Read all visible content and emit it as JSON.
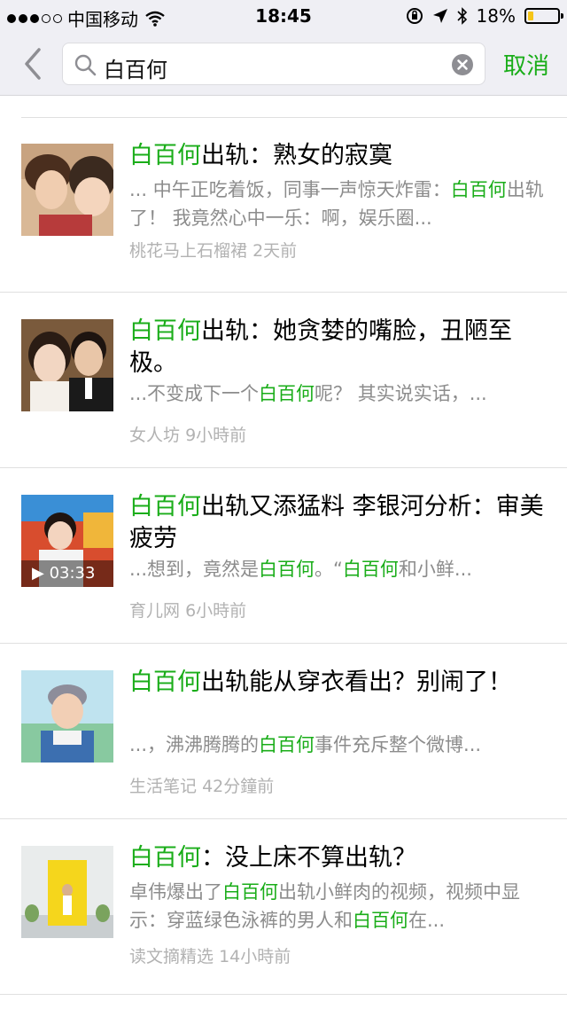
{
  "status_bar": {
    "carrier": "中国移动",
    "time": "18:45",
    "battery_percent": "18%",
    "battery_level": 0.18,
    "icons": [
      "signal-dots-icon",
      "wifi-icon",
      "orientation-lock-icon",
      "location-icon",
      "bluetooth-icon",
      "battery-icon"
    ]
  },
  "search": {
    "query": "白百何",
    "cancel_label": "取消"
  },
  "colors": {
    "accent": "#1aad19",
    "snippet": "#8c8c8c",
    "meta": "#b2b2b2",
    "header_bg": "#efeff4"
  },
  "results": [
    {
      "title": [
        {
          "t": "白百何",
          "hl": true
        },
        {
          "t": "出轨：熟女的寂寞",
          "hl": false
        }
      ],
      "snippet": [
        {
          "t": "... 中午正吃着饭，同事一声惊天炸雷：",
          "hl": false
        },
        {
          "t": "白百何",
          "hl": true
        },
        {
          "t": "出轨了！ 我竟然心中一乐：啊，娱乐圈...",
          "hl": false
        }
      ],
      "source": "桃花马上石榴裙",
      "time": "2天前"
    },
    {
      "title": [
        {
          "t": "白百何",
          "hl": true
        },
        {
          "t": "出轨：她贪婪的嘴脸，丑陋至极。",
          "hl": false
        }
      ],
      "snippet": [
        {
          "t": "...不变成下一个",
          "hl": false
        },
        {
          "t": "白百何",
          "hl": true
        },
        {
          "t": "呢？ 其实说实话，...",
          "hl": false
        }
      ],
      "source": "女人坊",
      "time": "9小時前"
    },
    {
      "title": [
        {
          "t": "白百何",
          "hl": true
        },
        {
          "t": "出轨又添猛料 李银河分析：审美疲劳",
          "hl": false
        }
      ],
      "snippet": [
        {
          "t": "...想到，竟然是",
          "hl": false
        },
        {
          "t": "白百何",
          "hl": true
        },
        {
          "t": "。“",
          "hl": false
        },
        {
          "t": "白百何",
          "hl": true
        },
        {
          "t": "和小鲜...",
          "hl": false
        }
      ],
      "source": "育儿网",
      "time": "6小時前",
      "video_duration": "03:33"
    },
    {
      "title": [
        {
          "t": "白百何",
          "hl": true
        },
        {
          "t": "出轨能从穿衣看出？别闹了！",
          "hl": false
        }
      ],
      "snippet": [
        {
          "t": "...，沸沸腾腾的",
          "hl": false
        },
        {
          "t": "白百何",
          "hl": true
        },
        {
          "t": "事件充斥整个微博...",
          "hl": false
        }
      ],
      "source": "生活笔记",
      "time": "42分鐘前"
    },
    {
      "title": [
        {
          "t": "白百何",
          "hl": true
        },
        {
          "t": "：没上床不算出轨？",
          "hl": false
        }
      ],
      "snippet": [
        {
          "t": "卓伟爆出了",
          "hl": false
        },
        {
          "t": "白百何",
          "hl": true
        },
        {
          "t": "出轨小鲜肉的视频，视频中显示：穿蓝绿色泳裤的男人和",
          "hl": false
        },
        {
          "t": "白百何",
          "hl": true
        },
        {
          "t": "在...",
          "hl": false
        }
      ],
      "source": "读文摘精选",
      "time": "14小時前"
    }
  ]
}
